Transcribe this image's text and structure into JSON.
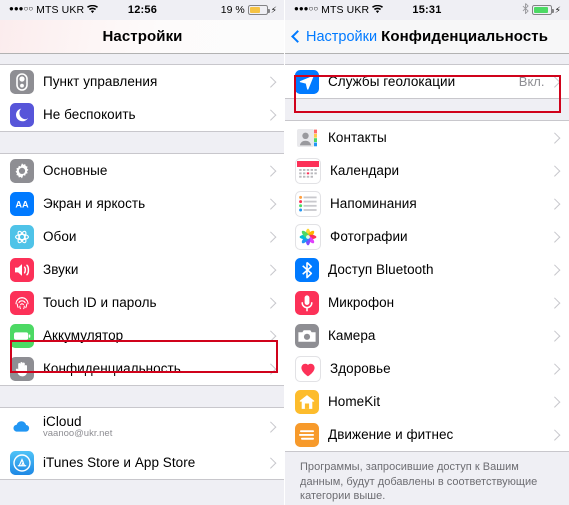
{
  "left_screen": {
    "status_bar": {
      "signal_dots": "●●●○○",
      "carrier": "MTS UKR",
      "time": "12:56",
      "battery_text": "19 %",
      "battery_level": 19,
      "battery_color": "#f6c343",
      "charging": true
    },
    "nav": {
      "title": "Настройки"
    },
    "groups": [
      {
        "rows": [
          {
            "label": "Пункт управления",
            "icon": "control-center-icon",
            "value": ""
          },
          {
            "label": "Не беспокоить",
            "icon": "moon-icon",
            "value": ""
          }
        ]
      },
      {
        "rows": [
          {
            "label": "Основные",
            "icon": "gear-icon",
            "value": ""
          },
          {
            "label": "Экран и яркость",
            "icon": "display-brightness-icon",
            "value": ""
          },
          {
            "label": "Обои",
            "icon": "wallpaper-icon",
            "value": ""
          },
          {
            "label": "Звуки",
            "icon": "sounds-icon",
            "value": ""
          },
          {
            "label": "Touch ID и пароль",
            "icon": "fingerprint-icon",
            "value": ""
          },
          {
            "label": "Аккумулятор",
            "icon": "battery-icon",
            "value": ""
          },
          {
            "label": "Конфиденциальность",
            "icon": "privacy-hand-icon",
            "value": "",
            "highlighted": true
          }
        ]
      },
      {
        "rows": [
          {
            "label": "iCloud",
            "sublabel": "vaanoo@ukr.net",
            "icon": "icloud-icon",
            "value": ""
          },
          {
            "label": "iTunes Store и App Store",
            "icon": "app-store-icon",
            "value": ""
          }
        ]
      }
    ]
  },
  "right_screen": {
    "status_bar": {
      "signal_dots": "●●●○○",
      "carrier": "MTS UKR",
      "time": "15:31",
      "battery_text": "",
      "battery_level": 72,
      "battery_color": "#4cd964",
      "charging": true,
      "bluetooth": true
    },
    "nav": {
      "back_label": "Настройки",
      "title": "Конфиденциальность"
    },
    "groups": [
      {
        "rows": [
          {
            "label": "Службы геолокации",
            "icon": "location-services-icon",
            "value": "Вкл.",
            "highlighted": true
          }
        ]
      },
      {
        "rows": [
          {
            "label": "Контакты",
            "icon": "contacts-icon",
            "value": ""
          },
          {
            "label": "Календари",
            "icon": "calendar-icon",
            "value": ""
          },
          {
            "label": "Напоминания",
            "icon": "reminders-icon",
            "value": ""
          },
          {
            "label": "Фотографии",
            "icon": "photos-icon",
            "value": ""
          },
          {
            "label": "Доступ Bluetooth",
            "icon": "bluetooth-icon",
            "value": ""
          },
          {
            "label": "Микрофон",
            "icon": "microphone-icon",
            "value": ""
          },
          {
            "label": "Камера",
            "icon": "camera-icon",
            "value": ""
          },
          {
            "label": "Здоровье",
            "icon": "health-icon",
            "value": ""
          },
          {
            "label": "HomeKit",
            "icon": "homekit-icon",
            "value": ""
          },
          {
            "label": "Движение и фитнес",
            "icon": "motion-fitness-icon",
            "value": ""
          }
        ]
      }
    ],
    "footer_note": "Программы, запросившие доступ к Вашим данным, будут добавлены в соответствующие категории выше."
  },
  "colors": {
    "highlight": "#d0021b",
    "accent_blue": "#007aff",
    "separator": "#d3d3d6",
    "page_bg": "#efeff4"
  }
}
